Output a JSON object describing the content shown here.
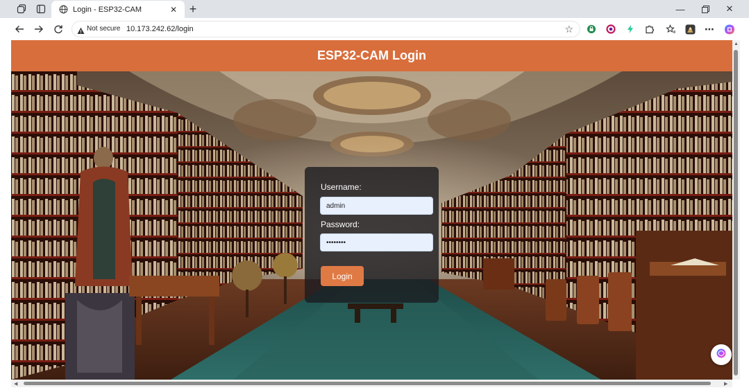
{
  "browser": {
    "tab": {
      "title": "Login - ESP32-CAM"
    },
    "address_bar": {
      "security_label": "Not secure",
      "url": "10.173.242.62/login"
    }
  },
  "page": {
    "header_title": "ESP32-CAM Login",
    "form": {
      "username_label": "Username:",
      "username_value": "admin",
      "password_label": "Password:",
      "password_value": "password",
      "login_button": "Login"
    }
  },
  "colors": {
    "header_bg": "#d86e3c",
    "button_bg": "#e07a45",
    "input_bg": "#e8f0fe",
    "form_bg": "rgba(28,28,32,0.80)"
  },
  "icons": [
    "workspaces-icon",
    "tab-actions-icon",
    "globe-icon",
    "close-icon",
    "new-tab-icon",
    "minimize-icon",
    "restore-icon",
    "window-close-icon",
    "back-icon",
    "forward-icon",
    "refresh-icon",
    "warning-icon",
    "star-icon",
    "extension-green-icon",
    "extension-ring-icon",
    "extension-bolt-icon",
    "extensions-puzzle-icon",
    "favorites-icon",
    "profile-icon",
    "more-icon",
    "copilot-icon"
  ]
}
